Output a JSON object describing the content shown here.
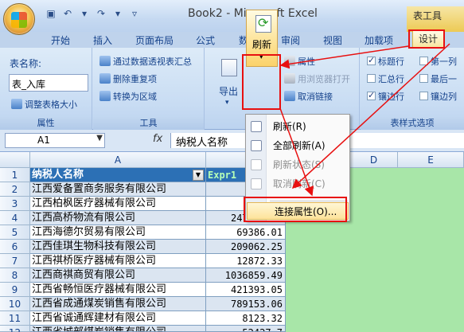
{
  "window": {
    "title": "Book2 - Microsoft Excel",
    "context_title": "表工具"
  },
  "quick_access": {
    "save": "save-icon",
    "undo": "↶",
    "redo": "↷"
  },
  "tabs": [
    "开始",
    "插入",
    "页面布局",
    "公式",
    "数据",
    "审阅",
    "视图",
    "加载项",
    "设计"
  ],
  "ribbon": {
    "props": {
      "table_name_label": "表名称:",
      "table_name_value": "表_入库",
      "resize": "调整表格大小",
      "group": "属性"
    },
    "tools": {
      "pivot": "通过数据透视表汇总",
      "remove_dup": "删除重复项",
      "to_range": "转换为区域",
      "group": "工具"
    },
    "external": {
      "export": "导出",
      "refresh": "刷新",
      "properties": "属性",
      "open_browser": "用浏览器打开",
      "unlink": "取消链接"
    },
    "style_options": {
      "header_row": "标题行",
      "total_row": "汇总行",
      "banded_rows": "镶边行",
      "first_col": "第一列",
      "last_col": "最后一",
      "banded_cols": "镶边列",
      "group": "表样式选项"
    }
  },
  "formula_bar": {
    "name_box": "A1",
    "fx": "fx",
    "content": "纳税人名称"
  },
  "menu": {
    "items": [
      {
        "label": "刷新(R)",
        "disabled": false
      },
      {
        "label": "全部刷新(A)",
        "disabled": false
      },
      {
        "label": "刷新状态(S)",
        "disabled": true
      },
      {
        "label": "取消刷新(C)",
        "disabled": true
      },
      {
        "label": "连接属性(O)...",
        "disabled": false
      }
    ]
  },
  "sheet": {
    "columns": [
      "A",
      "B",
      "D",
      "E"
    ],
    "header": {
      "a": "纳税人名称",
      "b": "Expr1"
    },
    "rows": [
      {
        "n": "1"
      },
      {
        "n": "2",
        "a": "江西爱备置商务服务有限公司",
        "b": ""
      },
      {
        "n": "3",
        "a": "江西柏枫医疗器械有限公司",
        "b": "20"
      },
      {
        "n": "4",
        "a": "江西高桥物流有限公司",
        "b": "247084.23"
      },
      {
        "n": "5",
        "a": "江西海德尔贸易有限公司",
        "b": "69386.01"
      },
      {
        "n": "6",
        "a": "江西佳琪生物科技有限公司",
        "b": "209062.25"
      },
      {
        "n": "7",
        "a": "江西祺桥医疗器械有限公司",
        "b": "12872.33"
      },
      {
        "n": "8",
        "a": "江西商祺商贸有限公司",
        "b": "1036859.49"
      },
      {
        "n": "9",
        "a": "江西省畅恒医疗器械有限公司",
        "b": "421393.05"
      },
      {
        "n": "10",
        "a": "江西省成通煤炭销售有限公司",
        "b": "789153.06"
      },
      {
        "n": "11",
        "a": "江西省诚通辉建材有限公司",
        "b": "8123.32"
      },
      {
        "n": "12",
        "a": "江西省城部煤炭销售有限公司",
        "b": "52427.7"
      }
    ]
  }
}
